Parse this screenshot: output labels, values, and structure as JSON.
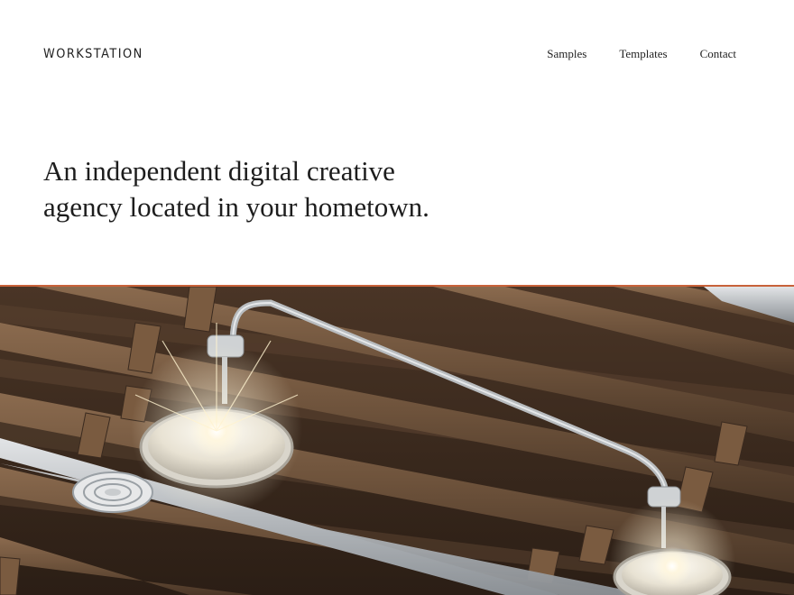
{
  "brand": {
    "name": "WORKSTATION"
  },
  "nav": {
    "items": [
      {
        "label": "Samples"
      },
      {
        "label": "Templates"
      },
      {
        "label": "Contact"
      }
    ]
  },
  "hero": {
    "headline_line1": "An independent digital creative",
    "headline_line2": "agency located in your hometown."
  },
  "colors": {
    "background": "#ffffff",
    "text": "#1f1f1f",
    "accent_line": "#c8623a"
  },
  "image": {
    "icon": "ceiling-photo"
  }
}
